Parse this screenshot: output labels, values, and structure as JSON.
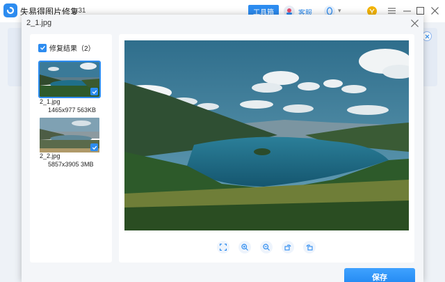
{
  "app": {
    "title": "失易得图片修复",
    "version": "1.31",
    "toolbox_label": "工具箱",
    "service_label": "客服",
    "user_chevron": "▾"
  },
  "dialog": {
    "title": "2_1.jpg",
    "select_all_label": "修复结果（2）",
    "files": [
      {
        "name": "2_1.jpg",
        "meta": "1465x977 563KB",
        "selected": true
      },
      {
        "name": "2_2.jpg",
        "meta": "5857x3905 3MB",
        "selected": true
      }
    ],
    "toolbar_icons": [
      "fit-screen-icon",
      "zoom-in-icon",
      "zoom-out-icon",
      "rotate-left-icon",
      "rotate-right-icon"
    ],
    "save_label": "保存"
  },
  "colors": {
    "accent": "#2d8cf0",
    "sky": "#3f7f9c",
    "lake": "#1e6b86",
    "forest": "#2f5a2c"
  }
}
